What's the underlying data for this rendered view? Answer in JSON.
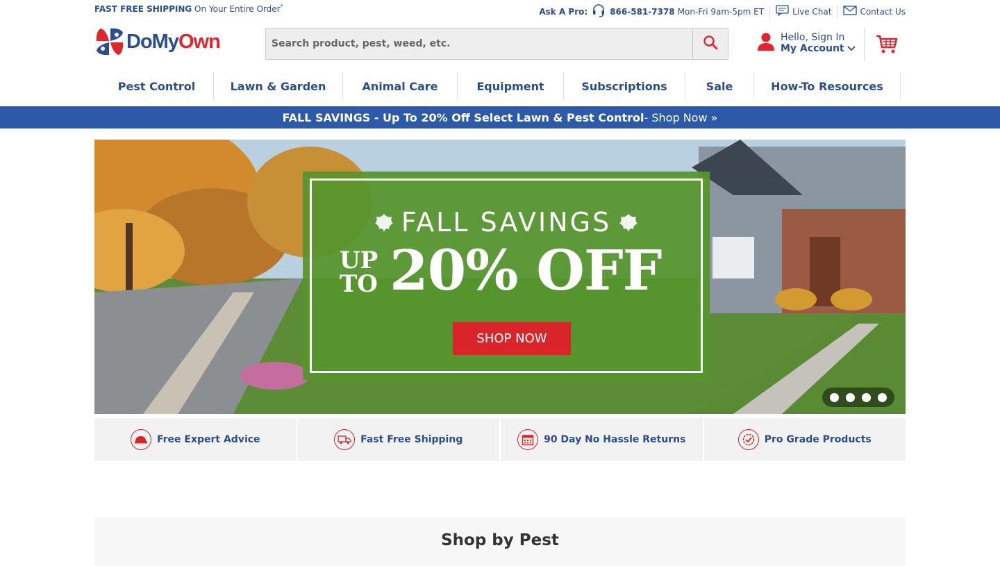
{
  "topbar": {
    "shipping_bold": "FAST FREE SHIPPING",
    "shipping_rest": " On Your Entire Order",
    "shipping_mark": "*",
    "ask_pro": "Ask A Pro:",
    "phone": "866-581-7378",
    "hours": "Mon-Fri 9am-5pm ET",
    "live_chat": "Live Chat",
    "contact_us": "Contact Us"
  },
  "header": {
    "logo_part1": "DoMy",
    "logo_part2": "Own",
    "search_placeholder": "Search product, pest, weed, etc.",
    "account_greeting": "Hello, Sign In",
    "account_label": "My Account"
  },
  "nav": [
    {
      "label": "Pest Control"
    },
    {
      "label": "Lawn & Garden"
    },
    {
      "label": "Animal Care"
    },
    {
      "label": "Equipment"
    },
    {
      "label": "Subscriptions"
    },
    {
      "label": "Sale"
    },
    {
      "label": "How-To Resources"
    }
  ],
  "promo": {
    "bold": "FALL SAVINGS - Up To 20% Off Select Lawn & Pest Control",
    "link": " - Shop Now »"
  },
  "hero": {
    "headline": "FALL SAVINGS",
    "up": "UP",
    "to": "TO",
    "discount": "20% OFF",
    "cta": "SHOP NOW",
    "slide_count": 4
  },
  "features": [
    {
      "label": "Free Expert Advice",
      "icon": "expert-cap-icon"
    },
    {
      "label": "Fast Free Shipping",
      "icon": "truck-icon"
    },
    {
      "label": "90 Day No Hassle Returns",
      "icon": "calendar-icon"
    },
    {
      "label": "Pro Grade Products",
      "icon": "badge-check-icon"
    }
  ],
  "shop_by_pest": {
    "title": "Shop by Pest"
  },
  "colors": {
    "brand_blue": "#2b4d8f",
    "promo_blue": "#2c5aa8",
    "brand_red": "#e0262d",
    "hero_green": "#56942c"
  }
}
